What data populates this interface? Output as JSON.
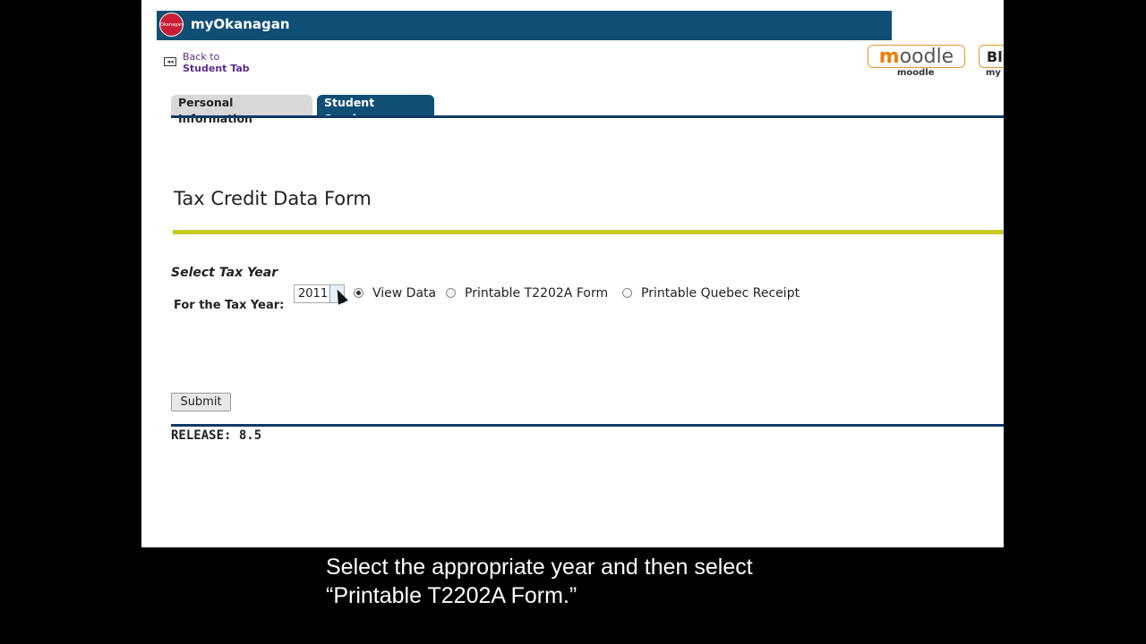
{
  "app": {
    "title": "myOkanagan",
    "logo_text": "Okanagan"
  },
  "back_link": {
    "line1": "Back to",
    "line2": "Student Tab"
  },
  "quick_links": {
    "moodle_label": "moodle",
    "bb_label": "my"
  },
  "tabs": [
    {
      "label": "Personal Information"
    },
    {
      "label": "Student Services"
    }
  ],
  "page": {
    "title": "Tax Credit Data Form",
    "section_heading": "Select Tax Year",
    "year_label": "For the Tax Year:",
    "selected_year": "2011",
    "options": [
      {
        "label": "View Data",
        "checked": true
      },
      {
        "label": "Printable T2202A Form",
        "checked": false
      },
      {
        "label": "Printable Quebec Receipt",
        "checked": false
      }
    ],
    "submit_label": "Submit",
    "release": "RELEASE: 8.5"
  },
  "caption": {
    "line1": "Select the appropriate year and then select",
    "line2": "“Printable T2202A Form.”"
  },
  "colors": {
    "header": "#0f4f75",
    "accent_rule": "#c8cc21",
    "logo": "#c81f37"
  }
}
